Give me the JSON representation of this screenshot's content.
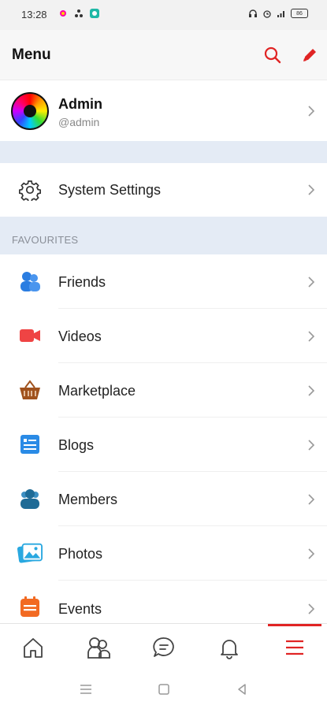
{
  "status_bar": {
    "time": "13:28",
    "battery": "86"
  },
  "header": {
    "title": "Menu"
  },
  "profile": {
    "name": "Admin",
    "handle": "@admin"
  },
  "system_settings": {
    "label": "System Settings"
  },
  "favourites": {
    "title": "FAVOURITES",
    "items": [
      {
        "label": "Friends",
        "icon": "friends-icon",
        "color": "#2a7de1"
      },
      {
        "label": "Videos",
        "icon": "video-camera-icon",
        "color": "#ef4444"
      },
      {
        "label": "Marketplace",
        "icon": "basket-icon",
        "color": "#a0521d"
      },
      {
        "label": "Blogs",
        "icon": "blog-icon",
        "color": "#2a8be6"
      },
      {
        "label": "Members",
        "icon": "members-icon",
        "color": "#1f6b96"
      },
      {
        "label": "Photos",
        "icon": "photos-icon",
        "color": "#29a8e0"
      },
      {
        "label": "Events",
        "icon": "calendar-icon",
        "color": "#f26a22"
      }
    ]
  },
  "bottom_nav": {
    "items": [
      "home-icon",
      "friends-nav-icon",
      "chat-icon",
      "bell-icon",
      "menu-icon"
    ],
    "active": "menu-icon",
    "accent": "#e02424"
  }
}
